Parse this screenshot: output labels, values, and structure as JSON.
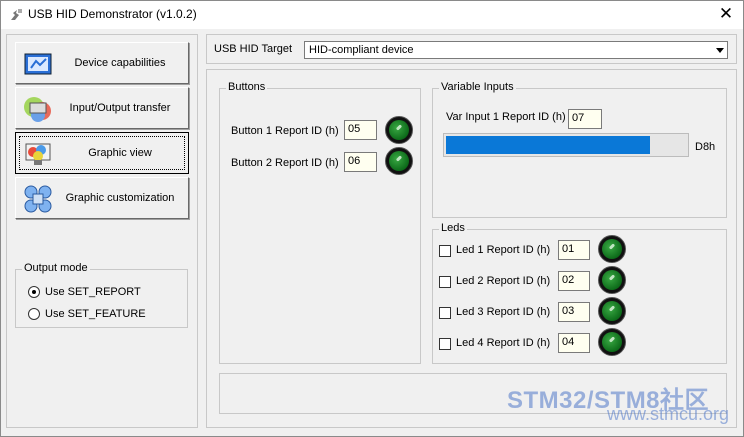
{
  "window": {
    "title": "USB HID Demonstrator (v1.0.2)",
    "close_glyph": "✕",
    "app_icon": "usb-hid-icon"
  },
  "nav": {
    "buttons": [
      {
        "label": "Device capabilities",
        "icon": "device-capabilities-icon"
      },
      {
        "label": "Input/Output transfer",
        "icon": "io-transfer-icon"
      },
      {
        "label": "Graphic view",
        "icon": "graphic-view-icon",
        "active": true
      },
      {
        "label": "Graphic customization",
        "icon": "graphic-customization-icon"
      }
    ]
  },
  "output_mode": {
    "title": "Output mode",
    "options": [
      {
        "label": "Use SET_REPORT",
        "checked": true
      },
      {
        "label": "Use SET_FEATURE",
        "checked": false
      }
    ]
  },
  "target": {
    "label": "USB HID Target",
    "value": "HID-compliant device"
  },
  "buttons_group": {
    "title": "Buttons",
    "items": [
      {
        "label": "Button 1 Report ID (h)",
        "value": "05",
        "led_color": "#1e8a2e"
      },
      {
        "label": "Button 2 Report ID (h)",
        "value": "06",
        "led_color": "#1e8a2e"
      }
    ]
  },
  "variable_inputs": {
    "title": "Variable Inputs",
    "label": "Var Input 1 Report ID (h)",
    "value": "07",
    "progress_fraction": 0.85,
    "progress_text": "D8h",
    "progress_color": "#0a78d7"
  },
  "leds_group": {
    "title": "Leds",
    "items": [
      {
        "label": "Led 1 Report ID (h)",
        "value": "01",
        "checked": false
      },
      {
        "label": "Led 2 Report ID (h)",
        "value": "02",
        "checked": false
      },
      {
        "label": "Led 3 Report ID (h)",
        "value": "03",
        "checked": false
      },
      {
        "label": "Led 4 Report ID (h)",
        "value": "04",
        "checked": false
      }
    ]
  },
  "watermark": {
    "line1": "STM32/STM8社区",
    "line2": "www.stmcu.org"
  }
}
